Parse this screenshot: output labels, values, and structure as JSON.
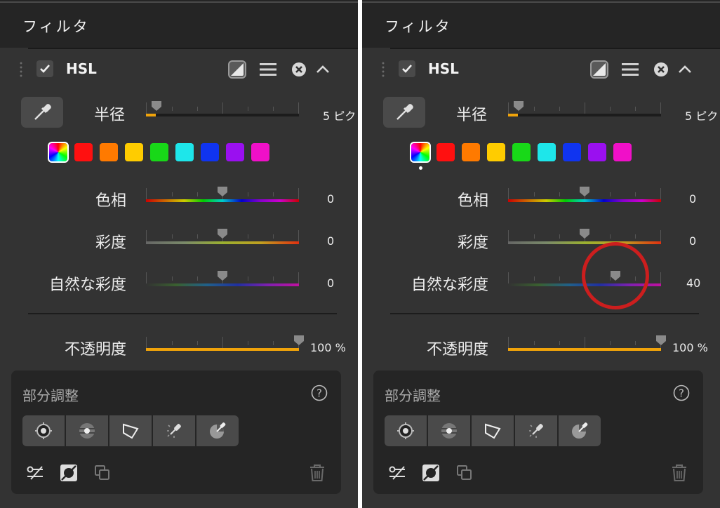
{
  "header_title": "フィルタ",
  "filter_name": "HSL",
  "radius": {
    "label": "半径",
    "value": "5 ピク"
  },
  "swatches": [
    {
      "name": "all-colors",
      "color": "conic"
    },
    {
      "name": "red",
      "color": "#ff1010"
    },
    {
      "name": "orange",
      "color": "#ff7a00"
    },
    {
      "name": "yellow",
      "color": "#ffcc00"
    },
    {
      "name": "green",
      "color": "#18d818"
    },
    {
      "name": "cyan",
      "color": "#1ee6ea"
    },
    {
      "name": "blue",
      "color": "#1034f0"
    },
    {
      "name": "purple",
      "color": "#9a10f0"
    },
    {
      "name": "magenta",
      "color": "#f010c8"
    }
  ],
  "left": {
    "hue": {
      "label": "色相",
      "value": "0"
    },
    "saturation": {
      "label": "彩度",
      "value": "0"
    },
    "vibrance": {
      "label": "自然な彩度",
      "value": "0"
    },
    "opacity": {
      "label": "不透明度",
      "value": "100 %"
    }
  },
  "right": {
    "hue": {
      "label": "色相",
      "value": "0"
    },
    "saturation": {
      "label": "彩度",
      "value": "0"
    },
    "vibrance": {
      "label": "自然な彩度",
      "value": "40"
    },
    "opacity": {
      "label": "不透明度",
      "value": "100 %"
    }
  },
  "local_adjust": {
    "title": "部分調整",
    "help": "?"
  },
  "colors": {
    "accent": "#f0a30a",
    "annotation": "#cc1e1e",
    "panel_bg": "#333333",
    "header_bg": "#252525"
  },
  "icons": {
    "header": [
      "checkbox-check-icon",
      "mask-square-icon",
      "menu-lines-icon",
      "close-circle-icon",
      "chevron-up-icon"
    ],
    "tools": [
      "control-point-icon",
      "radial-filter-icon",
      "polygon-icon",
      "brush-icon",
      "gradient-icon"
    ],
    "bottom": [
      "link-edit-icon",
      "mask-toggle-icon",
      "copy-icon",
      "trash-icon"
    ]
  }
}
